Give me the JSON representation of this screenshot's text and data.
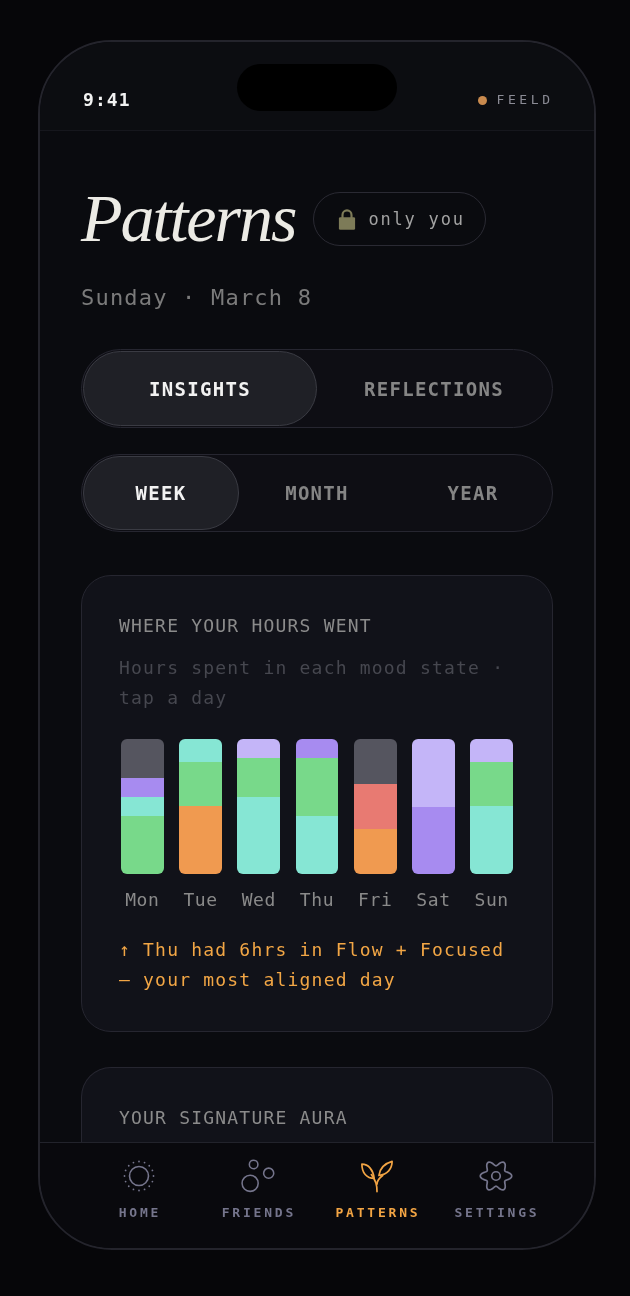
{
  "status_bar": {
    "time": "9:41",
    "brand": "FEELD"
  },
  "header": {
    "title": "Patterns",
    "privacy_badge": "only you",
    "date": "Sunday · March 8"
  },
  "view_tabs": [
    {
      "label": "INSIGHTS",
      "selected": true
    },
    {
      "label": "REFLECTIONS",
      "selected": false
    }
  ],
  "range_tabs": [
    {
      "label": "WEEK",
      "selected": true
    },
    {
      "label": "MONTH",
      "selected": false
    },
    {
      "label": "YEAR",
      "selected": false
    }
  ],
  "hours_card": {
    "title": "WHERE YOUR HOURS WENT",
    "subtitle": "Hours spent in each mood state · tap a day",
    "days": [
      "Mon",
      "Tue",
      "Wed",
      "Thu",
      "Fri",
      "Sat",
      "Sun"
    ],
    "insight": "↑ Thu had 6hrs in Flow + Focused — your most aligned day"
  },
  "aura_card": {
    "title": "YOUR SIGNATURE AURA"
  },
  "tab_bar": [
    {
      "label": "HOME",
      "selected": false
    },
    {
      "label": "FRIENDS",
      "selected": false
    },
    {
      "label": "PATTERNS",
      "selected": true
    },
    {
      "label": "SETTINGS",
      "selected": false
    }
  ]
}
